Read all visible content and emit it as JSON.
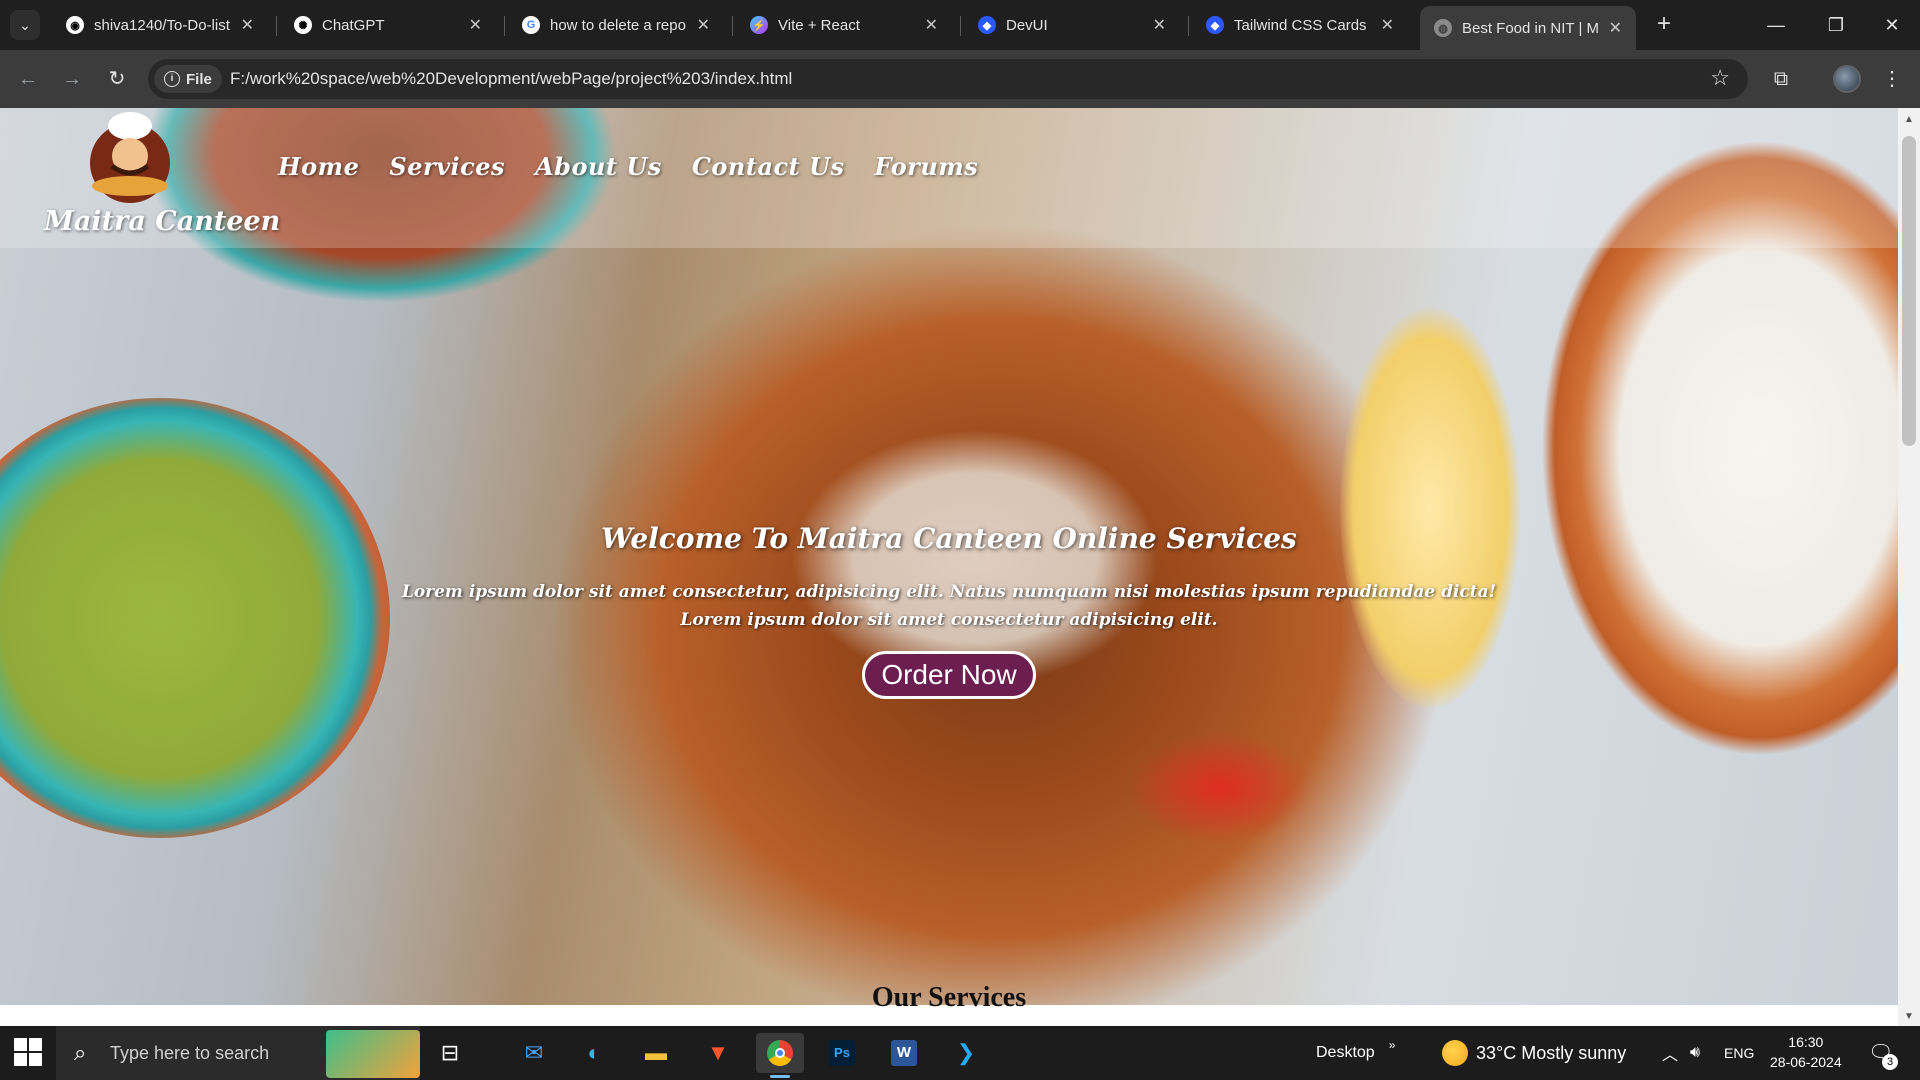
{
  "browser": {
    "tabs": [
      {
        "label": "shiva1240/To-Do-list",
        "icon": "github-icon",
        "active": false
      },
      {
        "label": "ChatGPT",
        "icon": "chatgpt-icon",
        "active": false
      },
      {
        "label": "how to delete a repo",
        "icon": "google-icon",
        "active": false
      },
      {
        "label": "Vite + React",
        "icon": "vite-icon",
        "active": false
      },
      {
        "label": "DevUI",
        "icon": "devui-icon",
        "active": false
      },
      {
        "label": "Tailwind CSS Cards -",
        "icon": "tailwind-icon",
        "active": false
      },
      {
        "label": "Best Food in NIT | Ma",
        "icon": "globe-icon",
        "active": true
      }
    ],
    "address": {
      "scheme_chip": "File",
      "url": "F:/work%20space/web%20Development/webPage/project%203/index.html"
    }
  },
  "page": {
    "brand": "Maitra Canteen",
    "nav": [
      "Home",
      "Services",
      "About Us",
      "Contact Us",
      "Forums"
    ],
    "hero": {
      "heading": "Welcome To Maitra Canteen Online Services",
      "line1": "Lorem ipsum dolor sit amet consectetur, adipisicing elit. Natus numquam nisi molestias ipsum repudiandae dicta!",
      "line2": "Lorem ipsum dolor sit amet consectetur adipisicing elit.",
      "cta": "Order Now"
    },
    "next_section_heading": "Our Services"
  },
  "taskbar": {
    "search_placeholder": "Type here to search",
    "desktop_label": "Desktop",
    "weather": "33°C  Mostly sunny",
    "language": "ENG",
    "time": "16:30",
    "date": "28-06-2024",
    "notification_count": "3"
  }
}
